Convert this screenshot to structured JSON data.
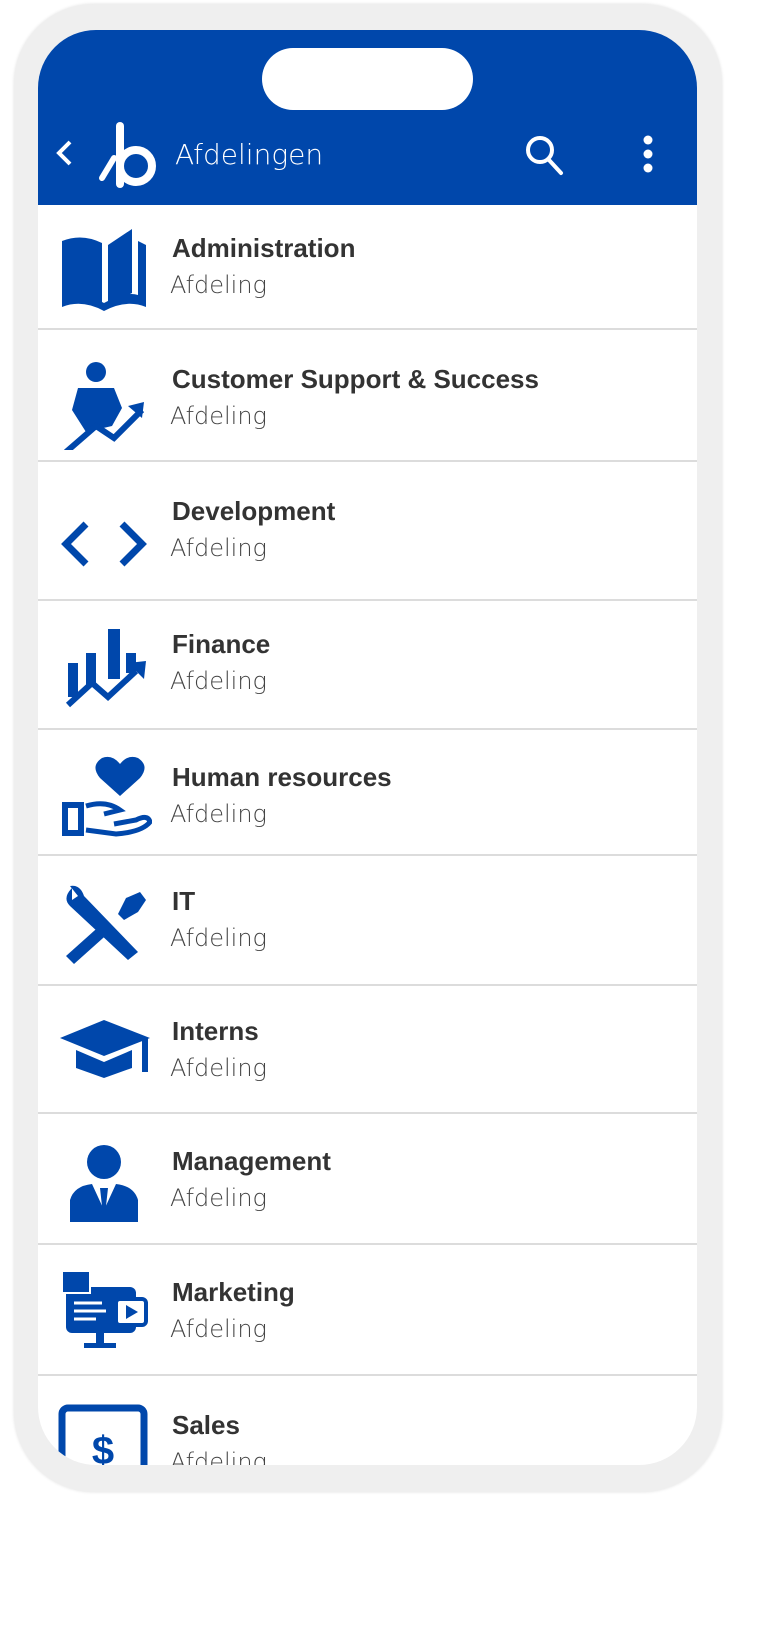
{
  "header": {
    "title": "Afdelingen",
    "back_icon": "chevron-left-icon",
    "logo_icon": "b-logo-icon",
    "search_icon": "search-icon",
    "more_icon": "more-vertical-icon",
    "color": "#0047ab"
  },
  "departments": [
    {
      "name": "Administration",
      "type": "Afdeling",
      "icon": "open-book-icon"
    },
    {
      "name": "Customer Support & Success",
      "type": "Afdeling",
      "icon": "person-growth-icon"
    },
    {
      "name": "Development",
      "type": "Afdeling",
      "icon": "code-brackets-icon"
    },
    {
      "name": "Finance",
      "type": "Afdeling",
      "icon": "bar-chart-trend-icon"
    },
    {
      "name": "Human resources",
      "type": "Afdeling",
      "icon": "hand-heart-icon"
    },
    {
      "name": "IT",
      "type": "Afdeling",
      "icon": "tools-icon"
    },
    {
      "name": "Interns",
      "type": "Afdeling",
      "icon": "graduation-cap-icon"
    },
    {
      "name": "Management",
      "type": "Afdeling",
      "icon": "manager-icon"
    },
    {
      "name": "Marketing",
      "type": "Afdeling",
      "icon": "media-monitor-icon"
    },
    {
      "name": "Sales",
      "type": "Afdeling",
      "icon": "dollar-screen-icon"
    }
  ]
}
